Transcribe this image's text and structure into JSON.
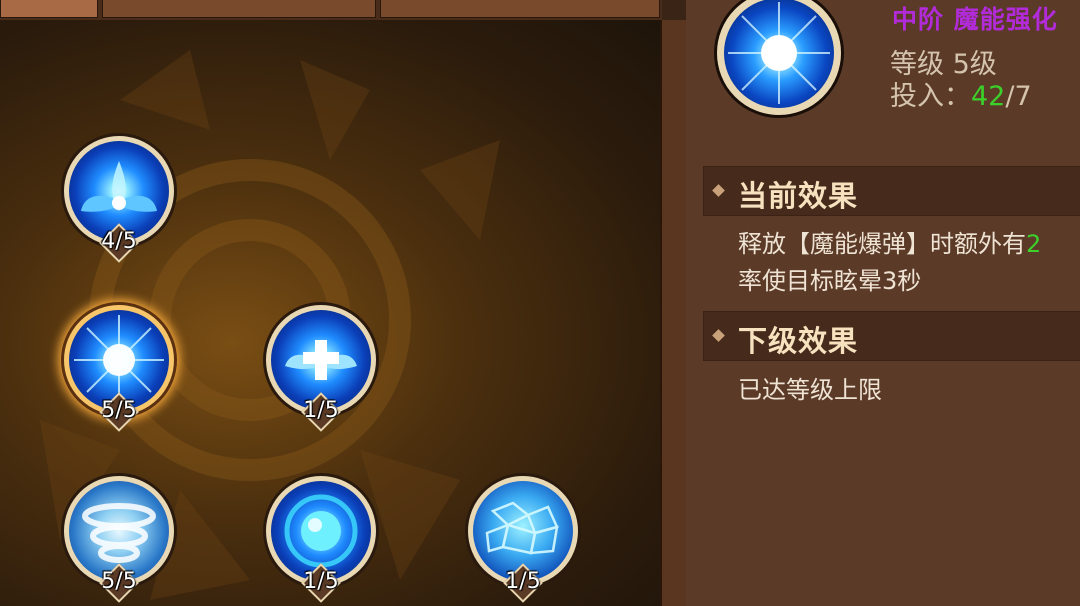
{
  "skill_tree": {
    "nodes": [
      {
        "id": "n1",
        "name": "spirit-bloom",
        "level": "4/5",
        "selected": false
      },
      {
        "id": "n2",
        "name": "magic-burst",
        "level": "5/5",
        "selected": true
      },
      {
        "id": "n3",
        "name": "holy-wings",
        "level": "1/5",
        "selected": false
      },
      {
        "id": "n4",
        "name": "whirlwind",
        "level": "5/5",
        "selected": false
      },
      {
        "id": "n5",
        "name": "energy-sphere",
        "level": "1/5",
        "selected": false
      },
      {
        "id": "n6",
        "name": "crystal-shield",
        "level": "1/5",
        "selected": false
      }
    ]
  },
  "info": {
    "title": "中阶  魔能强化",
    "level_line": "等级 5级",
    "invest_label": "投入：",
    "invest_value": "42",
    "invest_rest": "/7",
    "current_effect_title": "当前效果",
    "current_effect_line1_a": "释放【魔能爆弹】时额外有",
    "current_effect_line1_b": "2",
    "current_effect_line2": "率使目标眩晕3秒",
    "next_effect_title": "下级效果",
    "next_effect_text": "已达等级上限"
  },
  "colors": {
    "title": "#b22bd8",
    "highlight": "#3bd12a",
    "panel": "#5b3a28",
    "section": "#462a1b"
  }
}
